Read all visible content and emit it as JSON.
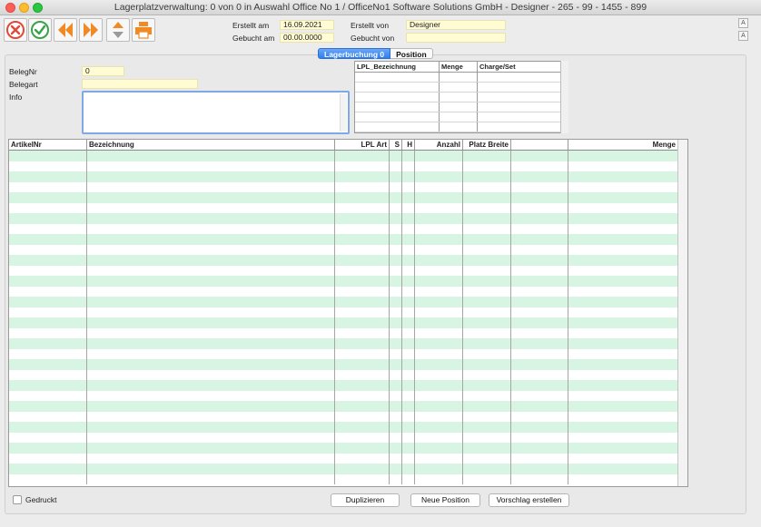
{
  "window": {
    "title": "Lagerplatzverwaltung: 0 von 0 in Auswahl Office No 1 /  OfficeNo1 Software Solutions GmbH - Designer - 265 - 99 - 1455 - 899"
  },
  "toolbar": {
    "buttons": [
      {
        "name": "cancel-icon",
        "color": "#e0493a"
      },
      {
        "name": "confirm-icon",
        "color": "#3aa24a"
      },
      {
        "name": "previous-icon",
        "color": "#f08a24"
      },
      {
        "name": "next-icon",
        "color": "#f08a24"
      },
      {
        "name": "sort-icon",
        "color": "#f08a24"
      },
      {
        "name": "print-icon",
        "color": "#f08a24"
      }
    ]
  },
  "header": {
    "erstellt_am_label": "Erstellt am",
    "erstellt_am_value": "16.09.2021",
    "gebucht_am_label": "Gebucht am",
    "gebucht_am_value": "00.00.0000",
    "erstellt_von_label": "Erstellt von",
    "erstellt_von_value": "Designer",
    "gebucht_von_label": "Gebucht von",
    "gebucht_von_value": ""
  },
  "side_buttons": {
    "top": "A",
    "bottom": "A"
  },
  "tabs": [
    {
      "label": "Lagerbuchung 0",
      "active": true
    },
    {
      "label": "Position",
      "active": false
    }
  ],
  "form": {
    "belegnr_label": "BelegNr",
    "belegnr_value": "0",
    "belegart_label": "Belegart",
    "belegart_value": "",
    "info_label": "Info",
    "info_value": ""
  },
  "small_table": {
    "columns": [
      "LPL_Bezeichnung",
      "Menge",
      "Charge/Set"
    ]
  },
  "grid": {
    "columns": [
      "ArtikelNr",
      "Bezeichnung",
      "LPL Art",
      "S",
      "H",
      "Anzahl",
      "Platz Breite",
      "",
      "Menge"
    ]
  },
  "footer": {
    "gedruckt_label": "Gedruckt",
    "duplizieren_label": "Duplizieren",
    "neue_position_label": "Neue Position",
    "vorschlag_label": "Vorschlag erstellen"
  }
}
